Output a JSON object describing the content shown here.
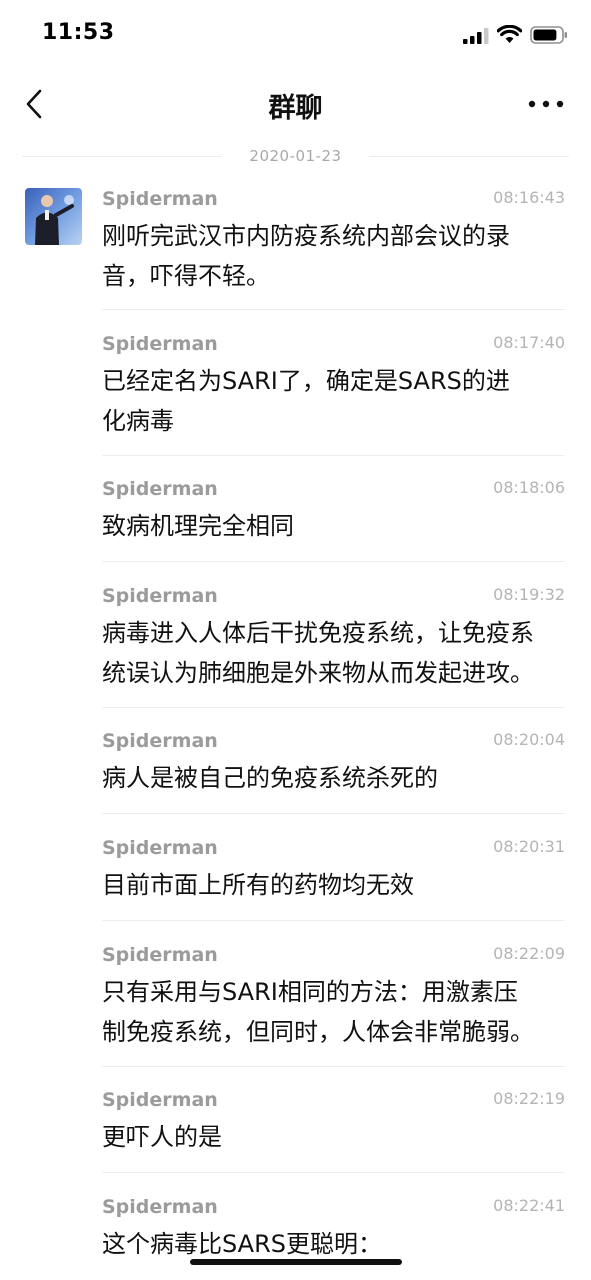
{
  "status_bar": {
    "time": "11:53",
    "battery_level": 0.85
  },
  "nav": {
    "title": "群聊",
    "back_icon": "chevron-left-icon",
    "more_icon": "more-horizontal-icon"
  },
  "date_divider": "2020-01-23",
  "messages": [
    {
      "sender": "Spiderman",
      "time": "08:16:43",
      "text": "刚听完武汉市内防疫系统内部会议的录\n音，吓得不轻。"
    },
    {
      "sender": "Spiderman",
      "time": "08:17:40",
      "text": "已经定名为SARI了，确定是SARS的进\n化病毒"
    },
    {
      "sender": "Spiderman",
      "time": "08:18:06",
      "text": "致病机理完全相同"
    },
    {
      "sender": "Spiderman",
      "time": "08:19:32",
      "text": "病毒进入人体后干扰免疫系统，让免疫系\n统误认为肺细胞是外来物从而发起进攻。"
    },
    {
      "sender": "Spiderman",
      "time": "08:20:04",
      "text": "病人是被自己的免疫系统杀死的"
    },
    {
      "sender": "Spiderman",
      "time": "08:20:31",
      "text": "目前市面上所有的药物均无效"
    },
    {
      "sender": "Spiderman",
      "time": "08:22:09",
      "text": "只有采用与SARI相同的方法：用激素压\n制免疫系统，但同时，人体会非常脆弱。"
    },
    {
      "sender": "Spiderman",
      "time": "08:22:19",
      "text": "更吓人的是"
    },
    {
      "sender": "Spiderman",
      "time": "08:22:41",
      "text": "这个病毒比SARS更聪明："
    }
  ]
}
